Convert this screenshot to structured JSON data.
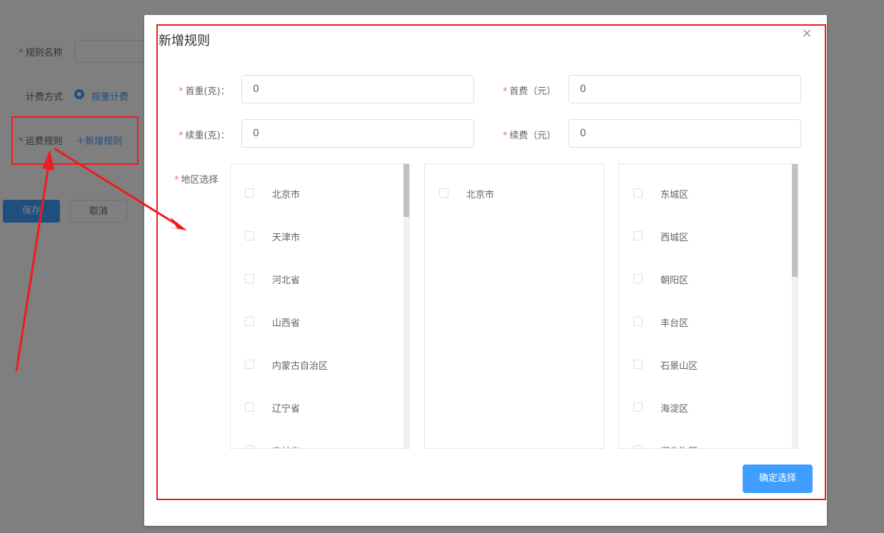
{
  "page": {
    "form": {
      "rule_name_label": "规则名称",
      "billing_method_label": "计费方式",
      "billing_method_value": "按重计费",
      "shipping_rules_label": "运费规则",
      "add_rule_link": "＋新增规则"
    },
    "buttons": {
      "save": "保存",
      "cancel": "取消"
    }
  },
  "dialog": {
    "title": "新增规则",
    "fields": {
      "first_weight": {
        "label": "首重(克)：",
        "value": "0"
      },
      "first_fee": {
        "label": "首费（元）",
        "value": "0"
      },
      "extra_weight": {
        "label": "续重(克)：",
        "value": "0"
      },
      "extra_fee": {
        "label": "续费（元）",
        "value": "0"
      }
    },
    "region_label": "地区选择",
    "provinces": [
      "北京市",
      "天津市",
      "河北省",
      "山西省",
      "内蒙古自治区",
      "辽宁省",
      "吉林省"
    ],
    "cities": [
      "北京市"
    ],
    "districts": [
      "东城区",
      "西城区",
      "朝阳区",
      "丰台区",
      "石景山区",
      "海淀区",
      "门头沟区"
    ],
    "confirm_label": "确定选择"
  },
  "colors": {
    "primary": "#409eff",
    "required": "#f56c6c",
    "annotation": "#ee1c1c"
  },
  "icons": {
    "close": "close-icon"
  }
}
